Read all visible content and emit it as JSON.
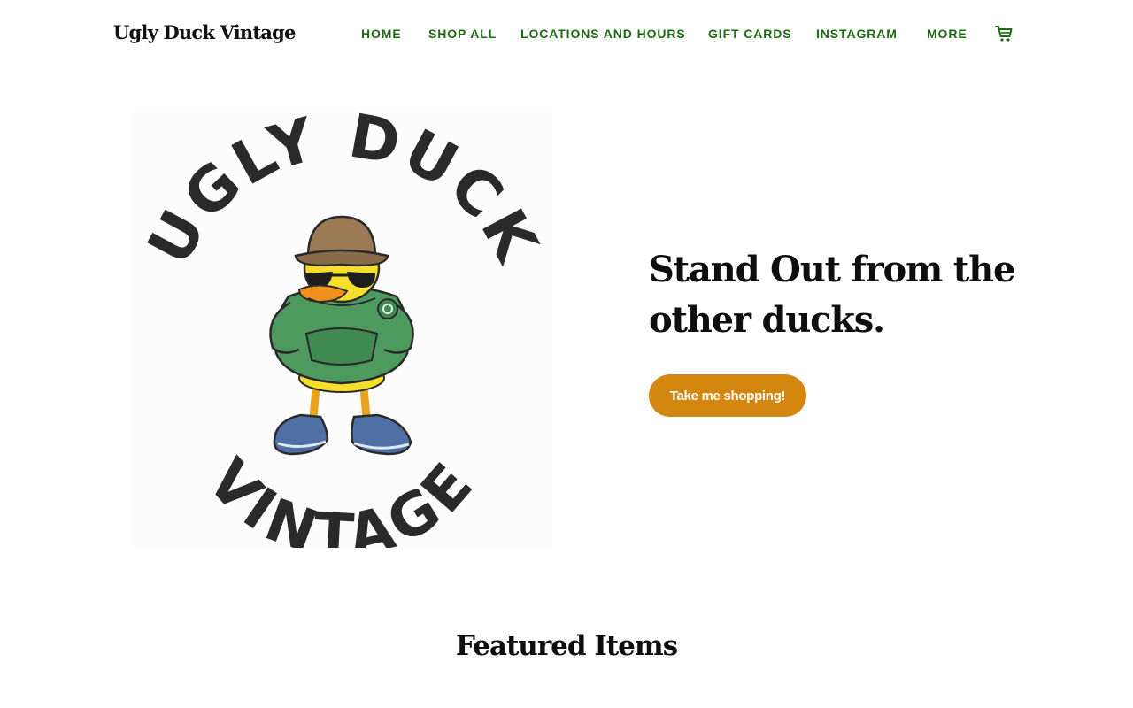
{
  "header": {
    "brand": "Ugly Duck Vintage",
    "nav": [
      {
        "label": "HOME"
      },
      {
        "label": "SHOP ALL"
      },
      {
        "label": "LOCATIONS AND HOURS"
      },
      {
        "label": "GIFT CARDS"
      },
      {
        "label": "INSTAGRAM"
      },
      {
        "label": "MORE"
      }
    ],
    "cart_icon": "shopping-cart-icon"
  },
  "hero": {
    "logo_text_top": "UGLY DUCK",
    "logo_text_bottom": "VINTAGE",
    "headline": "Stand Out from the other ducks.",
    "cta_label": "Take me shopping!"
  },
  "featured": {
    "title": "Featured Items"
  },
  "colors": {
    "nav_text": "#1c6b12",
    "cta_bg": "#d4870f",
    "heading": "#0e0e0e"
  }
}
